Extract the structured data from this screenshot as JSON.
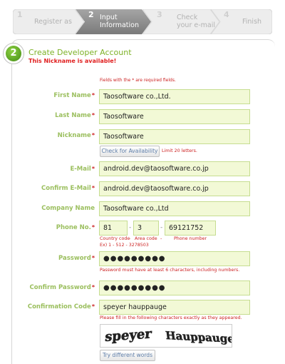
{
  "steps": [
    {
      "number": "1",
      "label": "Register as"
    },
    {
      "number": "2",
      "label_line1": "Input",
      "label_line2": "Information"
    },
    {
      "number": "3",
      "label_line1": "Check",
      "label_line2": "your e-mail"
    },
    {
      "number": "4",
      "label": "Finish"
    }
  ],
  "section": {
    "step_number": "2",
    "title": "Create Developer Account",
    "availability_message": "This Nickname is available!",
    "required_note_prefix": "Fields with the",
    "required_note_star": "*",
    "required_note_suffix": "are required fields."
  },
  "form": {
    "first_name": {
      "label": "First Name",
      "value": "Taosoftware co.,Ltd."
    },
    "last_name": {
      "label": "Last Name",
      "value": "Taosoftware"
    },
    "nickname": {
      "label": "Nickname",
      "value": "Taosoftware",
      "check_button": "Check for Availability",
      "limit_note": "Limit 20 letters."
    },
    "email": {
      "label": "E-Mail",
      "value": "android.dev@taosoftware.co.jp"
    },
    "confirm_email": {
      "label": "Confirm E-Mail",
      "value": "android.dev@taosoftware.co.jp"
    },
    "company_name": {
      "label": "Company Name",
      "value": "Taosoftware co.,Ltd"
    },
    "phone": {
      "label": "Phone No.",
      "country_code": "81",
      "area_code": "3",
      "number": "69121752",
      "separator": "-",
      "hint_country": "Country code",
      "hint_area": "Area code",
      "hint_number": "Phone number",
      "example": "Ex) 1 - 512 - 3278503"
    },
    "password": {
      "label": "Password",
      "value": "●●●●●●●●●",
      "hint": "Password must have at least 6 characters, including numbers."
    },
    "confirm_password": {
      "label": "Confirm Password",
      "value": "●●●●●●●●●"
    },
    "confirmation_code": {
      "label": "Confirmation Code",
      "value": "speyer hauppauge",
      "hint": "Please fill in the following characters exactly as they appeared.",
      "captcha_word1": "speyer",
      "captcha_word2": "Hauppauge",
      "retry_button": "Try different words"
    }
  },
  "colors": {
    "accent_green": "#7db227",
    "label_green": "#9bbf5e",
    "field_fill": "#f2f9d6",
    "error_red": "#e02020"
  }
}
